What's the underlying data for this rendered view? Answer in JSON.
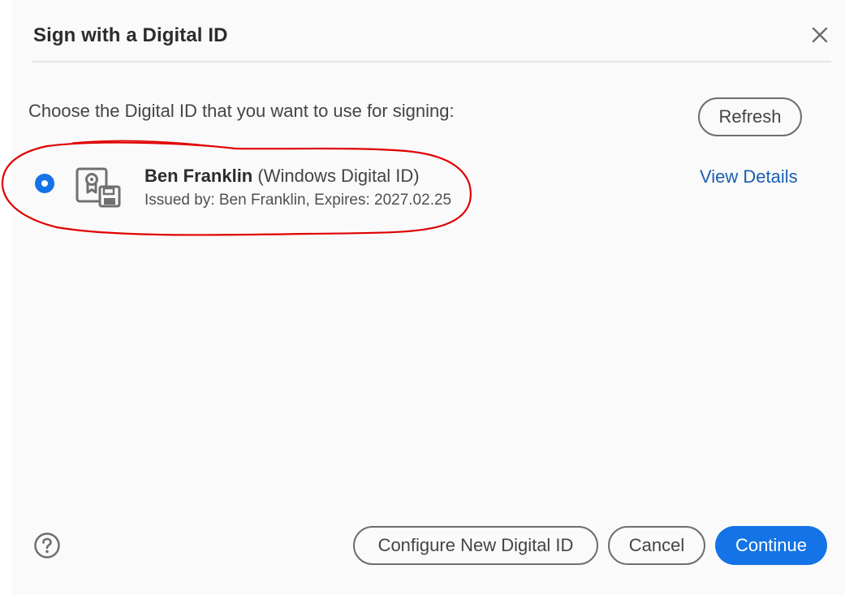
{
  "dialog": {
    "title": "Sign with a Digital ID",
    "close_icon": "close-icon"
  },
  "main": {
    "prompt": "Choose the Digital ID that you want to use for signing:",
    "refresh_label": "Refresh",
    "digital_ids": [
      {
        "selected": true,
        "icon": "certificate-icon",
        "name": "Ben Franklin",
        "type": "(Windows Digital ID)",
        "details": "Issued by: Ben Franklin, Expires: 2027.02.25",
        "view_details_label": "View Details"
      }
    ]
  },
  "footer": {
    "help_icon": "help-icon",
    "configure_label": "Configure New Digital ID",
    "cancel_label": "Cancel",
    "continue_label": "Continue"
  },
  "colors": {
    "accent": "#1473e6",
    "link": "#1a5fb4",
    "annotation": "#e00000",
    "background": "#fafafa"
  }
}
